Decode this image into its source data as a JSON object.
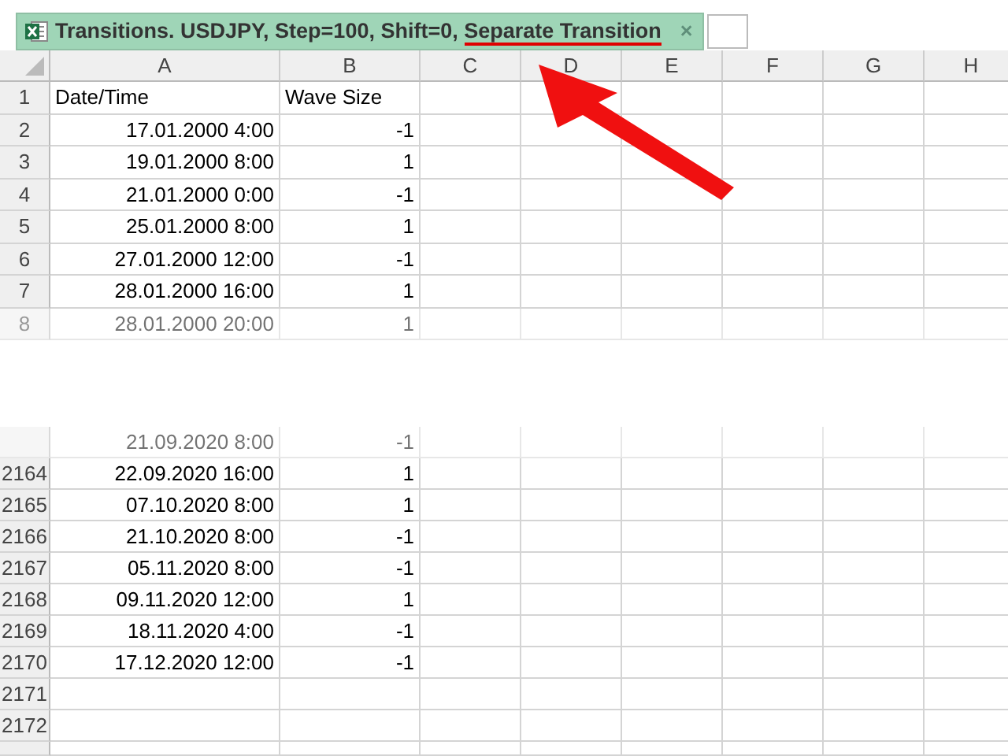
{
  "tab": {
    "title_parts": [
      {
        "text": "Transitions. USDJPY, Step=100, Shift=0, ",
        "underlined": false
      },
      {
        "text": "Separate Transition",
        "underlined": true
      }
    ],
    "close_glyph": "×"
  },
  "columns": [
    "A",
    "B",
    "C",
    "D",
    "E",
    "F",
    "G",
    "H"
  ],
  "top_rows": [
    {
      "number": "1",
      "date": "Date/Time",
      "wave": "",
      "kind": "header",
      "faded": false
    },
    {
      "number": "2",
      "date": "17.01.2000 4:00",
      "wave": "-1",
      "kind": "data",
      "faded": false
    },
    {
      "number": "3",
      "date": "19.01.2000 8:00",
      "wave": "1",
      "kind": "data",
      "faded": false
    },
    {
      "number": "4",
      "date": "21.01.2000 0:00",
      "wave": "-1",
      "kind": "data",
      "faded": false
    },
    {
      "number": "5",
      "date": "25.01.2000 8:00",
      "wave": "1",
      "kind": "data",
      "faded": false
    },
    {
      "number": "6",
      "date": "27.01.2000 12:00",
      "wave": "-1",
      "kind": "data",
      "faded": false
    },
    {
      "number": "7",
      "date": "28.01.2000 16:00",
      "wave": "1",
      "kind": "data",
      "faded": false
    },
    {
      "number": "8",
      "date": "28.01.2000 20:00",
      "wave": "1",
      "kind": "data",
      "faded": true
    }
  ],
  "header_wave": "Wave Size",
  "bottom_rows": [
    {
      "date": "21.09.2020 8:00",
      "wave": "-1",
      "kind": "data",
      "faded": true
    },
    {
      "number": "2164",
      "date": "22.09.2020 16:00",
      "wave": "1",
      "kind": "data",
      "faded": false
    },
    {
      "number": "2165",
      "date": "07.10.2020 8:00",
      "wave": "1",
      "kind": "data",
      "faded": false
    },
    {
      "number": "2166",
      "date": "21.10.2020 8:00",
      "wave": "-1",
      "kind": "data",
      "faded": false
    },
    {
      "number": "2167",
      "date": "05.11.2020 8:00",
      "wave": "-1",
      "kind": "data",
      "faded": false
    },
    {
      "number": "2168",
      "date": "09.11.2020 12:00",
      "wave": "1",
      "kind": "data",
      "faded": false
    },
    {
      "number": "2169",
      "date": "18.11.2020 4:00",
      "wave": "-1",
      "kind": "data",
      "faded": false
    },
    {
      "number": "2170",
      "date": "17.12.2020 12:00",
      "wave": "-1",
      "kind": "data",
      "faded": false
    },
    {
      "number": "2171",
      "kind": "empty",
      "faded": false
    },
    {
      "number": "2172",
      "kind": "empty",
      "faded": false
    }
  ]
}
